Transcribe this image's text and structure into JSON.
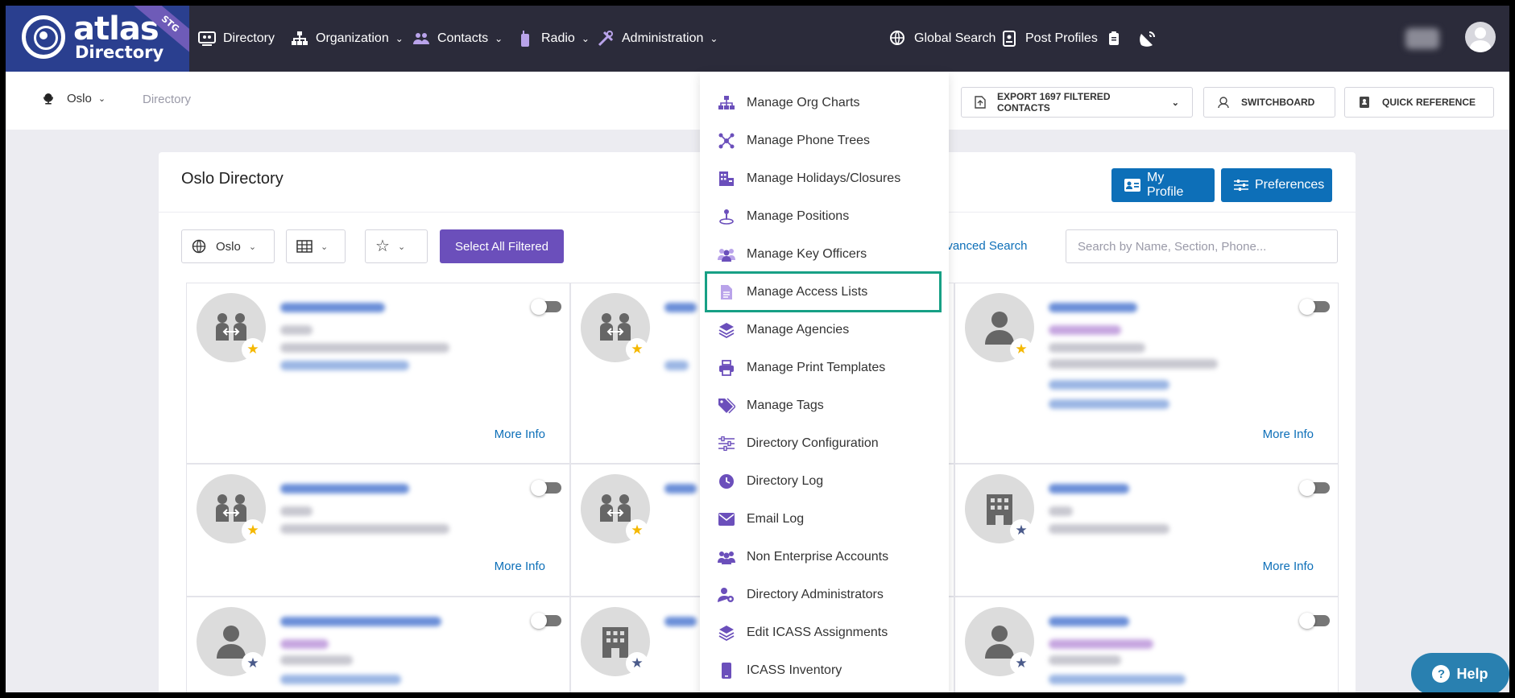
{
  "brand": {
    "name": "atlas",
    "sub": "Directory",
    "env_badge": "STG"
  },
  "nav": {
    "items": [
      {
        "label": "Directory",
        "icon": "monitor-users-icon"
      },
      {
        "label": "Organization",
        "icon": "sitemap-icon"
      },
      {
        "label": "Contacts",
        "icon": "contacts-icon"
      },
      {
        "label": "Radio",
        "icon": "radio-icon"
      },
      {
        "label": "Administration",
        "icon": "tools-icon"
      }
    ],
    "right": [
      {
        "label": "Global Search",
        "icon": "globe-search-icon"
      },
      {
        "label": "Post Profiles",
        "icon": "id-card-icon"
      }
    ]
  },
  "subbar": {
    "location": "Oslo",
    "breadcrumb": "Directory",
    "export_label": "EXPORT 1697 FILTERED CONTACTS",
    "switchboard_label": "SWITCHBOARD",
    "quick_reference_label": "QUICK REFERENCE"
  },
  "card": {
    "title": "Oslo Directory",
    "my_profile_label": "My Profile",
    "preferences_label": "Preferences",
    "location_filter": "Oslo",
    "select_all_label": "Select All Filtered",
    "advanced_search_label": "dvanced Search",
    "search_placeholder": "Search by Name, Section, Phone...",
    "more_info_label": "More Info"
  },
  "admin_menu": {
    "items": [
      {
        "label": "Manage Org Charts",
        "icon": "org-chart-icon"
      },
      {
        "label": "Manage Phone Trees",
        "icon": "phone-tree-icon"
      },
      {
        "label": "Manage Holidays/Closures",
        "icon": "building-calendar-icon"
      },
      {
        "label": "Manage Positions",
        "icon": "position-icon"
      },
      {
        "label": "Manage Key Officers",
        "icon": "key-officers-icon"
      },
      {
        "label": "Manage Access Lists",
        "icon": "document-icon"
      },
      {
        "label": "Manage Agencies",
        "icon": "layers-icon"
      },
      {
        "label": "Manage Print Templates",
        "icon": "printer-icon"
      },
      {
        "label": "Manage Tags",
        "icon": "tags-icon"
      },
      {
        "label": "Directory Configuration",
        "icon": "sliders-icon"
      },
      {
        "label": "Directory Log",
        "icon": "clock-icon"
      },
      {
        "label": "Email Log",
        "icon": "envelope-icon"
      },
      {
        "label": "Non Enterprise Accounts",
        "icon": "users-icon"
      },
      {
        "label": "Directory Administrators",
        "icon": "user-gear-icon"
      },
      {
        "label": "Edit ICASS Assignments",
        "icon": "layers-icon"
      },
      {
        "label": "ICASS Inventory",
        "icon": "mobile-icon"
      }
    ],
    "highlighted": "Manage Access Lists"
  },
  "help_label": "Help",
  "colors": {
    "nav_bg": "#2b2b3a",
    "brand_bg": "#2a3f8f",
    "primary_blue": "#0d6fb8",
    "purple": "#6b4fbb",
    "highlight": "#17a085",
    "star_yellow": "#f5b800",
    "star_slate": "#4a5a8a"
  }
}
